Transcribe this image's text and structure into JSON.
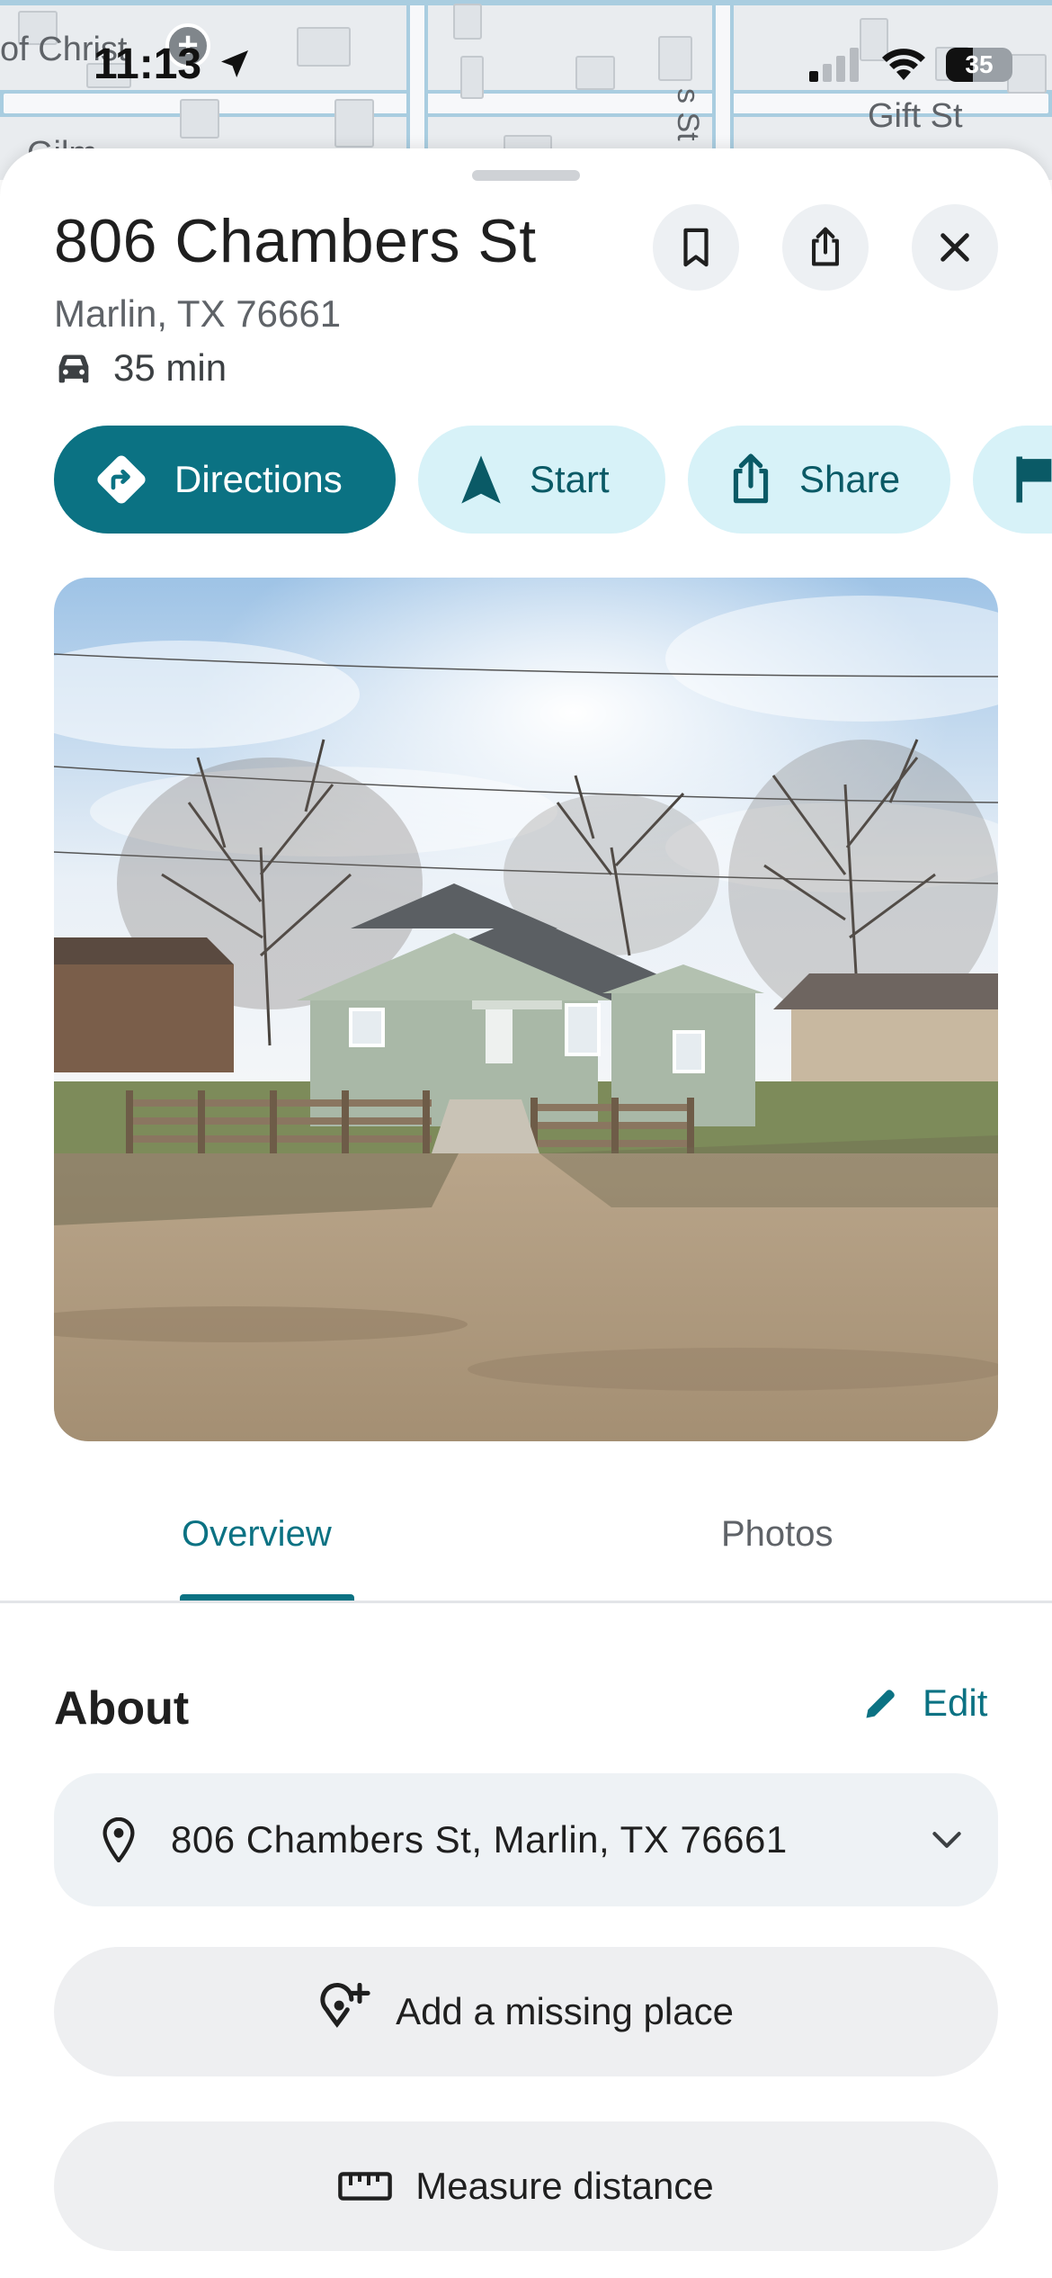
{
  "status_bar": {
    "time": "11:13",
    "battery": "35"
  },
  "map": {
    "labels": [
      "of Christ",
      "Gift St",
      "s St",
      "Gilm"
    ]
  },
  "place": {
    "title": "806 Chambers St",
    "subtitle": "Marlin, TX 76661",
    "drive_time": "35 min"
  },
  "header_buttons": {
    "save": "bookmark-icon",
    "share": "share-icon",
    "close": "close-icon"
  },
  "actions": [
    {
      "label": "Directions",
      "icon": "directions-icon"
    },
    {
      "label": "Start",
      "icon": "navigation-arrow-icon"
    },
    {
      "label": "Share",
      "icon": "share-icon"
    },
    {
      "label": "",
      "icon": "flag-icon"
    }
  ],
  "tabs": [
    {
      "label": "Overview",
      "active": true
    },
    {
      "label": "Photos",
      "active": false
    }
  ],
  "about": {
    "heading": "About",
    "edit_label": "Edit",
    "address": "806 Chambers St, Marlin, TX 76661"
  },
  "buttons": {
    "add_missing_place": "Add a missing place",
    "measure_distance": "Measure distance"
  },
  "colors": {
    "accent": "#0b7283",
    "chip_light": "#d7f2f8"
  }
}
